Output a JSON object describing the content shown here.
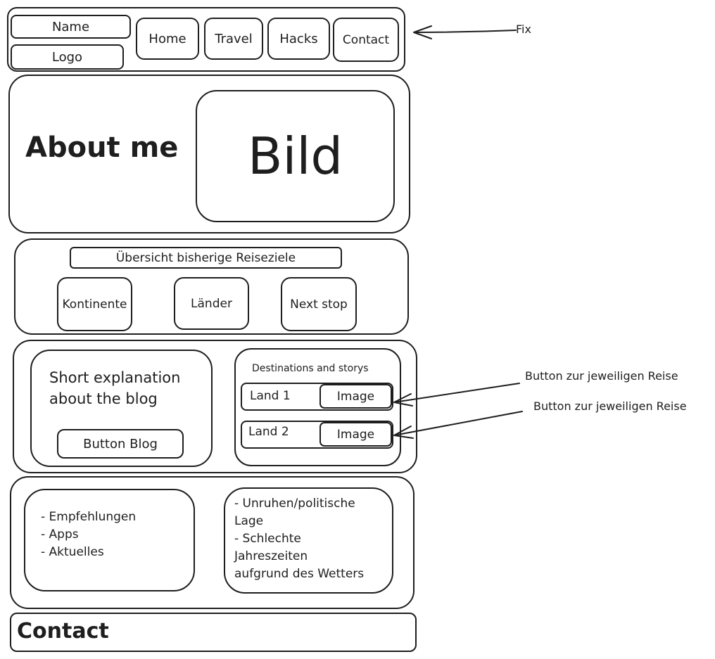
{
  "header": {
    "name": "Name",
    "logo": "Logo",
    "nav": [
      "Home",
      "Travel",
      "Hacks",
      "Contact"
    ],
    "fix_note": "Fix"
  },
  "about": {
    "title": "About me",
    "image": "Bild"
  },
  "overview": {
    "title": "Übersicht bisherige Reiseziele",
    "buttons": [
      "Kontinente",
      "Länder",
      "Next stop"
    ]
  },
  "blog": {
    "text_line1": "Short explanation",
    "text_line2": "about the blog",
    "button": "Button Blog",
    "destinations_title": "Destinations and storys",
    "rows": [
      {
        "land": "Land 1",
        "image": "Image"
      },
      {
        "land": "Land 2",
        "image": "Image"
      }
    ],
    "annotation": "Button zur jeweiligen Reise"
  },
  "tips": {
    "left": [
      "- Empfehlungen",
      "- Apps",
      "- Aktuelles"
    ],
    "right": [
      "- Unruhen/politische",
      "Lage",
      "- Schlechte",
      "Jahreszeiten",
      "aufgrund des Wetters"
    ]
  },
  "footer": {
    "contact": "Contact"
  }
}
